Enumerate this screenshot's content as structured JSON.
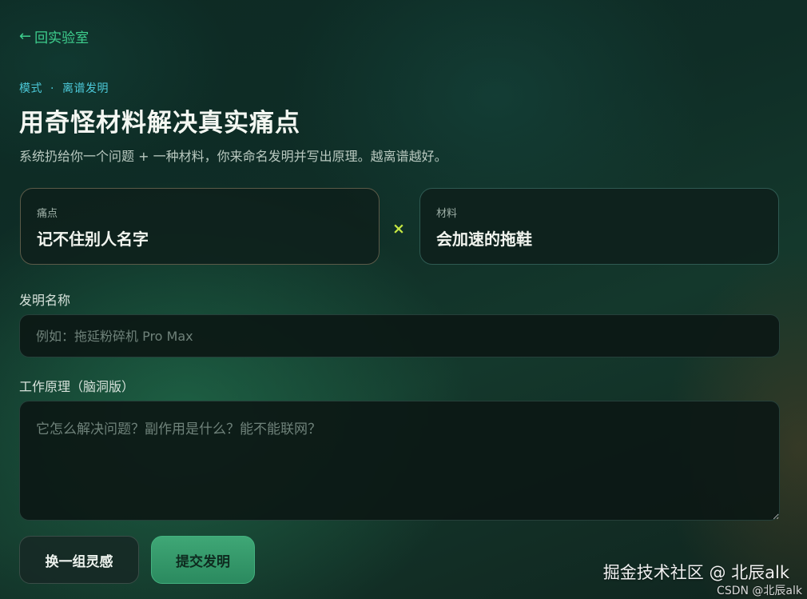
{
  "nav": {
    "back_arrow": "←",
    "back_label": "回实验室"
  },
  "header": {
    "mode_prefix": "模式",
    "mode_separator": "·",
    "mode_name": "离谱发明",
    "title": "用奇怪材料解决真实痛点",
    "subtitle": "系统扔给你一个问题 + 一种材料，你来命名发明并写出原理。越离谱越好。"
  },
  "cards": {
    "pain": {
      "label": "痛点",
      "value": "记不住别人名字"
    },
    "times_symbol": "×",
    "material": {
      "label": "材料",
      "value": "会加速的拖鞋"
    }
  },
  "form": {
    "name_label": "发明名称",
    "name_placeholder": "例如：拖延粉碎机 Pro Max",
    "principle_label": "工作原理（脑洞版）",
    "principle_placeholder": "它怎么解决问题？副作用是什么？能不能联网？"
  },
  "actions": {
    "shuffle_label": "换一组灵感",
    "submit_label": "提交发明"
  },
  "watermark": {
    "main": "掘金技术社区 @ 北辰alk",
    "sub": "CSDN @北辰alk"
  },
  "colors": {
    "accent_green": "#3ecf8e",
    "accent_cyan": "#4cc9d9",
    "times_yellow": "#c6e843",
    "submit_bg": "#2b8a5f"
  }
}
